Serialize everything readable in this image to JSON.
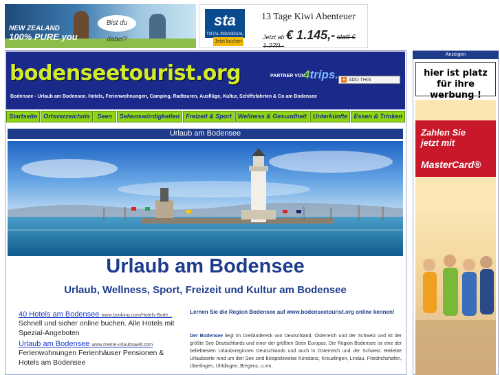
{
  "banners": {
    "nz": {
      "line1": "NEW ZEALAND",
      "line2": "100% PURE you",
      "bubble": "Bist du dabei?"
    },
    "sta": {
      "logo": "sta",
      "logo_sub": "TOTAL INDIVIDUAL",
      "book": "Jetzt buchen",
      "title": "13 Tage Kiwi Abenteuer",
      "price_prefix": "Jetzt ab",
      "price": "€ 1.145,-",
      "old_price": "statt € 1.270,-"
    }
  },
  "header": {
    "logo": "bodenseetourist.org",
    "partner_label": "PARTNER VON",
    "partner_logo_a": "4",
    "partner_logo_b": "trips.",
    "addthis": "ADD THIS",
    "tagline": "Bodensee - Urlaub am Bodensee. Hotels, Ferienwohnungen, Camping, Radtouren, Ausflüge, Kultur, Schiffsfahrten & Co am Bodensee"
  },
  "nav": [
    {
      "label": "Startseite"
    },
    {
      "label": "Ortsverzeichnis"
    },
    {
      "label": "Seen"
    },
    {
      "label": "Sehenswürdigkeiten"
    },
    {
      "label": "Freizeit & Sport"
    },
    {
      "label": "Wellness & Gesundheit"
    },
    {
      "label": "Unterkünfte"
    },
    {
      "label": "Essen & Trinken"
    }
  ],
  "content": {
    "bar_title": "Urlaub am Bodensee",
    "heading": "Urlaub am Bodensee",
    "subheading": "Urlaub, Wellness, Sport, Freizeit und Kultur am Bodensee"
  },
  "ads": [
    {
      "title": "40 Hotels am Bodensee",
      "url": "www.booking.com/Hotels-Bode...",
      "text": "Schnell und sicher online buchen. Alle Hotels mit Spezial-Angeboten"
    },
    {
      "title": "Urlaub am Bodensee",
      "url": "www.meine-urlaubswelt.com",
      "text": "Ferienwohnungen Ferienhäuser Pensionen & Hotels am Bodensee"
    }
  ],
  "body": {
    "intro": "Lernen Sie die Region Bodensee auf www.bodenseetourist.org online kennen!",
    "lead": "Der Bodensee",
    "text": "liegt im Dreiländereck von Deutschland, Österreich und der Schweiz und ist der größte See Deutschlands und einer der größten Seen Europas. Die Region Bodensee ist eine der beliebtesten Urlaubsregionen Deutschlands und auch in Österreich und der Schweiz. Beliebte Urlaubsorte rund um den See sind beispielsweise Konstanz, Kreuzlingen, Lindau, Friedrichshafen, Überlingen, Uhldingen, Bregenz, u.vm."
  },
  "sidebar": {
    "label": "Anzeigen",
    "adspace": "hier ist platz für ihre werbung !",
    "mc_line1": "Zahlen Sie",
    "mc_line2": "jetzt mit",
    "mc_brand": "MasterCard®"
  }
}
